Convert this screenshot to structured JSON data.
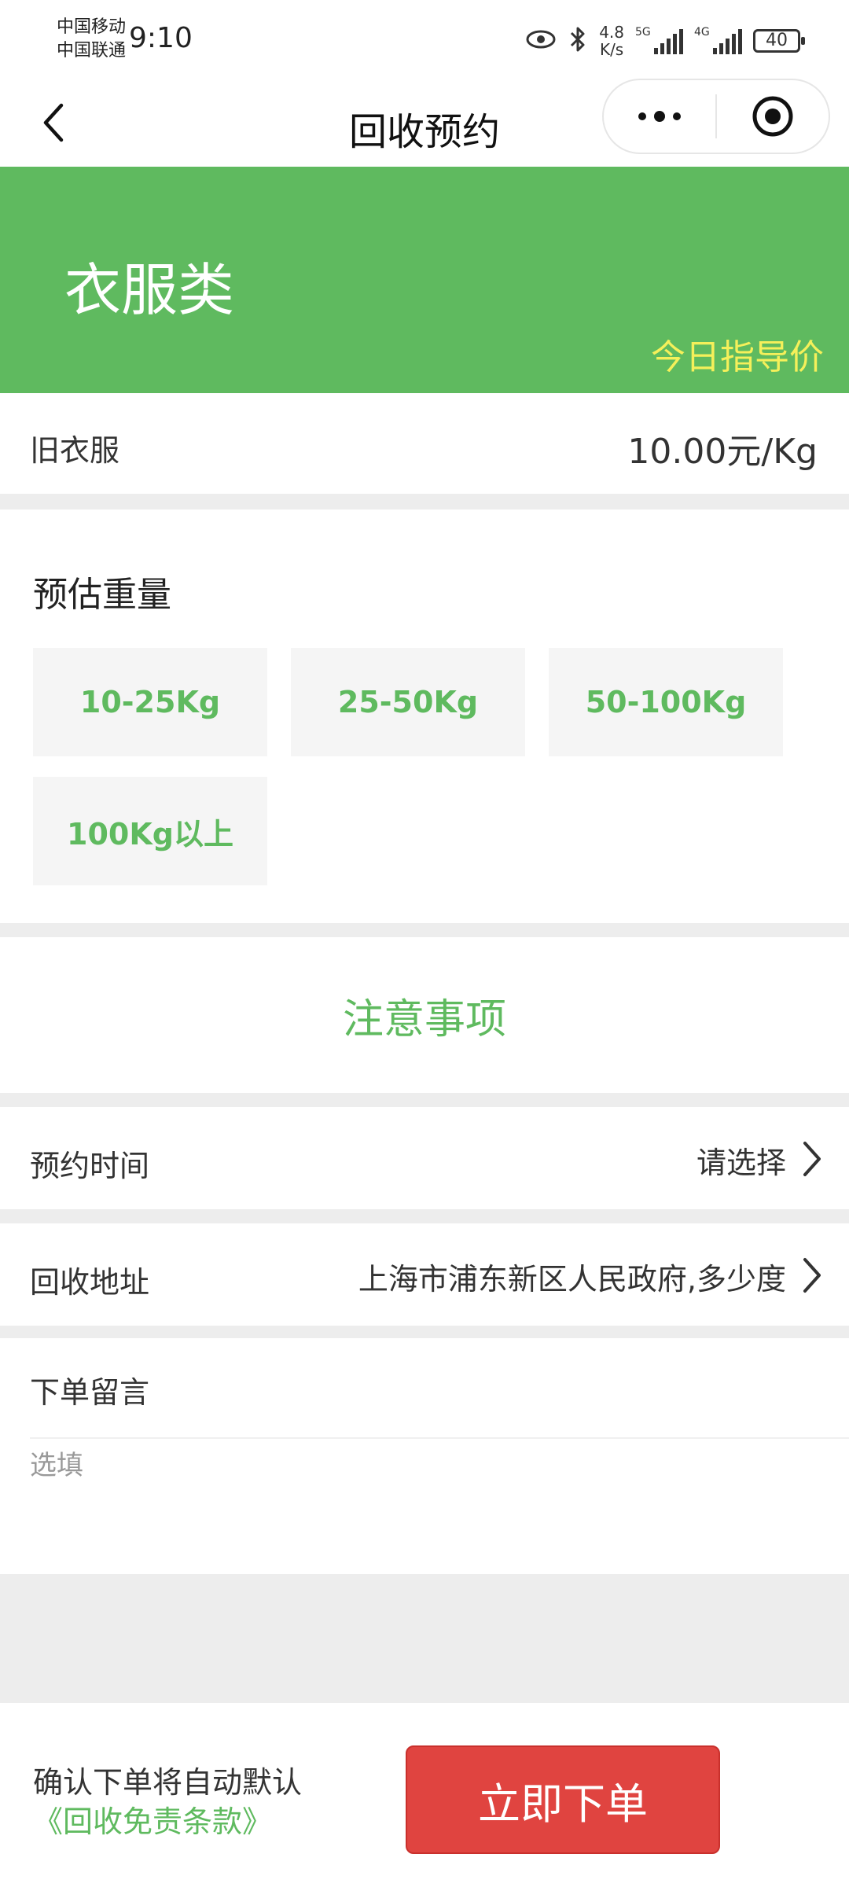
{
  "status_bar": {
    "carrier_1": "中国移动",
    "carrier_2": "中国联通",
    "time": "9:10",
    "net_speed_value": "4.8",
    "net_speed_unit": "K/s",
    "signal_1_tag": "5G",
    "signal_2_tag": "4G",
    "battery": "40"
  },
  "nav": {
    "title": "回收预约"
  },
  "banner": {
    "category": "衣服类",
    "price_guide": "今日指导价"
  },
  "price": {
    "item": "旧衣服",
    "value": "10.00元/Kg"
  },
  "weight": {
    "title": "预估重量",
    "options": [
      "10-25Kg",
      "25-50Kg",
      "50-100Kg",
      "100Kg以上"
    ]
  },
  "notice": {
    "title": "注意事项"
  },
  "appointment": {
    "label": "预约时间",
    "value": "请选择"
  },
  "address": {
    "label": "回收地址",
    "value": "上海市浦东新区人民政府,多少度"
  },
  "message": {
    "label": "下单留言",
    "placeholder": "选填"
  },
  "footer": {
    "agree_text": "确认下单将自动默认",
    "agree_link": "《回收免责条款》",
    "submit_label": "立即下单"
  },
  "colors": {
    "brand_green": "#5fba5f",
    "price_yellow": "#f5f05a",
    "submit_red": "#e04440"
  }
}
